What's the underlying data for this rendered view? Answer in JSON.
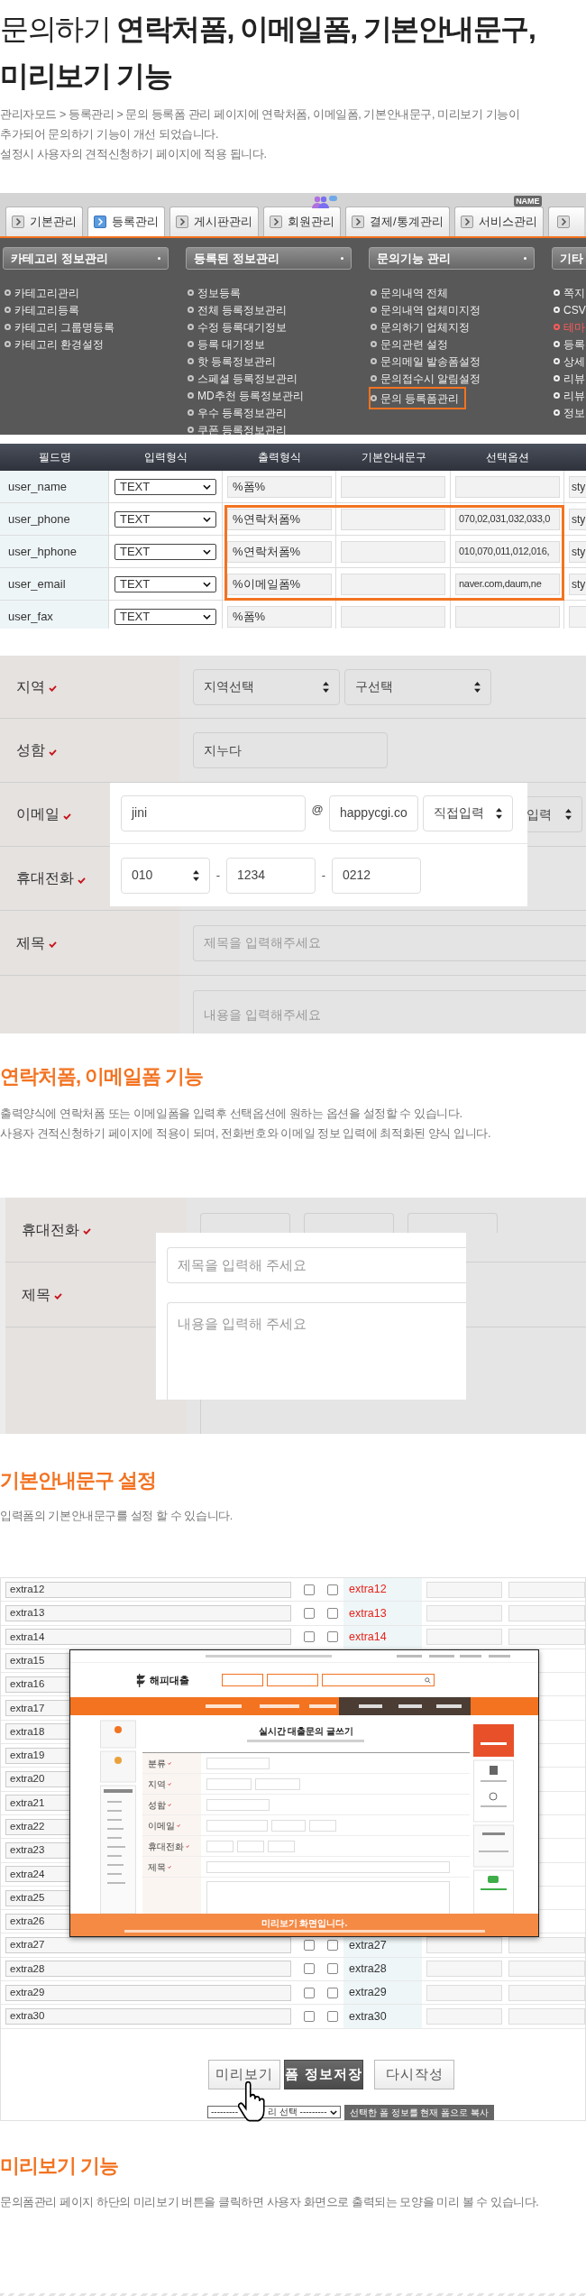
{
  "header": {
    "title": "문의하기 **연락처폼, 이메일폼, 기본안내문구, 미리보기 기능**",
    "description": [
      "관리자모드 > 등록관리 > 문의 등록폼 관리 페이지에 연락처폼, 이메일폼, 기본안내문구, 미리보기 기능이",
      "추가되어 문의하기 기능이 개선 되었습니다.",
      "설정시 사용자의 견적신청하기 페이지에 적용 됩니다."
    ]
  },
  "admin_menu": {
    "tabs": [
      {
        "label": "기본관리",
        "selected": false
      },
      {
        "label": "등록관리",
        "selected": true
      },
      {
        "label": "게시판관리",
        "selected": false
      },
      {
        "label": "회원관리",
        "selected": false,
        "badge": {
          "kind": "people"
        }
      },
      {
        "label": "결제/통계관리",
        "selected": false
      },
      {
        "label": "서비스관리",
        "selected": false,
        "badge": {
          "kind": "tag",
          "text": "NAME"
        }
      }
    ],
    "columns": [
      {
        "title": "카테고리 정보관리",
        "items": [
          {
            "label": "카테고리관리",
            "selected": false
          },
          {
            "label": "카테고리등록",
            "selected": false
          },
          {
            "label": "카테고리 그룹명등록",
            "selected": false
          },
          {
            "label": "카테고리 환경설정",
            "selected": false
          }
        ]
      },
      {
        "title": "등록된 정보관리",
        "items": [
          {
            "label": "정보등록",
            "selected": false
          },
          {
            "label": "전체 등록정보관리",
            "selected": false
          },
          {
            "label": "수정 등록대기정보",
            "selected": false
          },
          {
            "label": "등록 대기정보",
            "selected": false
          },
          {
            "label": "핫 등록정보관리",
            "selected": false
          },
          {
            "label": "스페셜 등록정보관리",
            "selected": false
          },
          {
            "label": "MD추천 등록정보관리",
            "selected": false
          },
          {
            "label": "우수 등록정보관리",
            "selected": false
          },
          {
            "label": "쿠폰 등록정보관리",
            "selected": false
          }
        ]
      },
      {
        "title": "문의기능 관리",
        "items": [
          {
            "label": "문의내역 전체",
            "selected": false
          },
          {
            "label": "문의내역 업체미지정",
            "selected": false
          },
          {
            "label": "문의하기 업체지정",
            "selected": false
          },
          {
            "label": "문의관련 설정",
            "selected": false
          },
          {
            "label": "문의메일 발송폼설정",
            "selected": false
          },
          {
            "label": "문의접수시 알림설정",
            "selected": false
          },
          {
            "label": "문의 등록폼관리",
            "selected": true
          }
        ]
      },
      {
        "title": "기타",
        "items": [
          {
            "label": "쪽지",
            "selected": false,
            "color": "#f0f0f0"
          },
          {
            "label": "CSV",
            "selected": false,
            "color": "#f0f0f0"
          },
          {
            "label": "테마",
            "selected": false,
            "color": "#ff5a5a"
          },
          {
            "label": "등록",
            "selected": false,
            "color": "#f0f0f0"
          },
          {
            "label": "상세",
            "selected": false,
            "color": "#f0f0f0"
          },
          {
            "label": "리뷰",
            "selected": false,
            "color": "#f0f0f0"
          },
          {
            "label": "리뷰",
            "selected": false,
            "color": "#f0f0f0"
          },
          {
            "label": "정보",
            "selected": false,
            "color": "#f0f0f0"
          }
        ]
      }
    ]
  },
  "field_table": {
    "columns": [
      "필드명",
      "입력형식",
      "출력형식",
      "기본안내문구",
      "선택옵션"
    ],
    "rows": [
      {
        "field": "user_name",
        "input_type": "TEXT",
        "output_format": "%폼%",
        "column_6": "sty",
        "highlighted": false
      },
      {
        "field": "user_phone",
        "input_type": "TEXT",
        "output_format": "%연락처폼%",
        "options": "070,02,031,032,033,0",
        "column_6": "sty",
        "highlighted": true
      },
      {
        "field": "user_hphone",
        "input_type": "TEXT",
        "output_format": "%연락처폼%",
        "options": "010,070,011,012,016,",
        "column_6": "sty",
        "highlighted": true
      },
      {
        "field": "user_email",
        "input_type": "TEXT",
        "output_format": "%이메일폼%",
        "options": "naver.com,daum,ne",
        "column_6": "sty",
        "highlighted": true
      },
      {
        "field": "user_fax",
        "input_type": "TEXT",
        "output_format": "%폼%",
        "highlighted": false
      }
    ]
  },
  "sample_form": {
    "region": {
      "label": "지역",
      "required": true,
      "selects": [
        "지역선택",
        "구선택"
      ]
    },
    "name": {
      "label": "성함",
      "required": true,
      "value": "지누다"
    },
    "email": {
      "label": "이메일",
      "required": true,
      "local": "jini",
      "at": "@",
      "domain": "happycgi.co",
      "domain_select": "직접입력",
      "hidden_select": "입력"
    },
    "phone": {
      "label": "휴대전화",
      "required": true,
      "prefix": "010",
      "separators": [
        "-",
        "-"
      ],
      "middle": "1234",
      "last": "0212"
    },
    "subject": {
      "label": "제목",
      "required": true,
      "placeholder": "제목을 입력해주세요"
    },
    "content": {
      "placeholder": "내용을 입력해주세요"
    }
  },
  "section_contact": {
    "heading": "연락처폼, 이메일폼 기능",
    "description": [
      "출력양식에 연락처폼 또는 이메일폼을 입력후 선택옵션에 원하는 옵션을 설정할 수 있습니다.",
      "사용자 견적신청하기 페이지에 적용이 되며, 전화번호와 이메일 정보 입력에 최적화된 양식 입니다."
    ]
  },
  "guide_form": {
    "phone_label": "휴대전화",
    "phone_required": true,
    "subject_label": "제목",
    "subject_required": true,
    "subject_placeholder": "제목을 입력해 주세요",
    "content_placeholder": "내용을 입력해 주세요"
  },
  "section_guide": {
    "heading": "기본안내문구 설정",
    "description": [
      "입력폼의 기본안내문구를 설정 할 수 있습니다."
    ]
  },
  "extra_table": {
    "rows": [
      {
        "name": "extra12",
        "checks": [
          false,
          false
        ],
        "code": "extra12",
        "in_use": true
      },
      {
        "name": "extra13",
        "checks": [
          false,
          false
        ],
        "code": "extra13",
        "in_use": true
      },
      {
        "name": "extra14",
        "checks": [
          false,
          false
        ],
        "code": "extra14",
        "in_use": true
      },
      {
        "name": "extra15"
      },
      {
        "name": "extra16"
      },
      {
        "name": "extra17"
      },
      {
        "name": "extra18"
      },
      {
        "name": "extra19"
      },
      {
        "name": "extra20"
      },
      {
        "name": "extra21"
      },
      {
        "name": "extra22"
      },
      {
        "name": "extra23"
      },
      {
        "name": "extra24"
      },
      {
        "name": "extra25"
      },
      {
        "name": "extra26"
      },
      {
        "name": "extra27",
        "checks": [
          false,
          false
        ],
        "code": "extra27",
        "in_use": false
      },
      {
        "name": "extra28",
        "checks": [
          false,
          false
        ],
        "code": "extra28",
        "in_use": false
      },
      {
        "name": "extra29",
        "checks": [
          false,
          false
        ],
        "code": "extra29",
        "in_use": false
      },
      {
        "name": "extra30",
        "checks": [
          false,
          false
        ],
        "code": "extra30",
        "in_use": false
      }
    ],
    "preview": {
      "logo": "해피대출",
      "title": "실시간 대출문의 글쓰기",
      "labels": [
        "분류",
        "지역",
        "성함",
        "이메일",
        "휴대전화",
        "제목"
      ],
      "banner": "미리보기 화면입니다."
    },
    "buttons": [
      {
        "label": "미리보기",
        "kind": "light"
      },
      {
        "label": "폼 정보저장",
        "kind": "dark"
      },
      {
        "label": "다시작성",
        "kind": "light"
      }
    ],
    "copy_select": [
      "---------",
      "리 선택 ---------"
    ],
    "copy_button": "선택한 폼 정보를 현재 폼으로 복사"
  },
  "section_preview": {
    "heading": "미리보기 기능",
    "description": [
      "문의폼관리 페이지 하단의 미리보기 버튼을 클릭하면 사용자 화면으로 출력되는 모양을 미리 볼 수 있습니다."
    ]
  }
}
